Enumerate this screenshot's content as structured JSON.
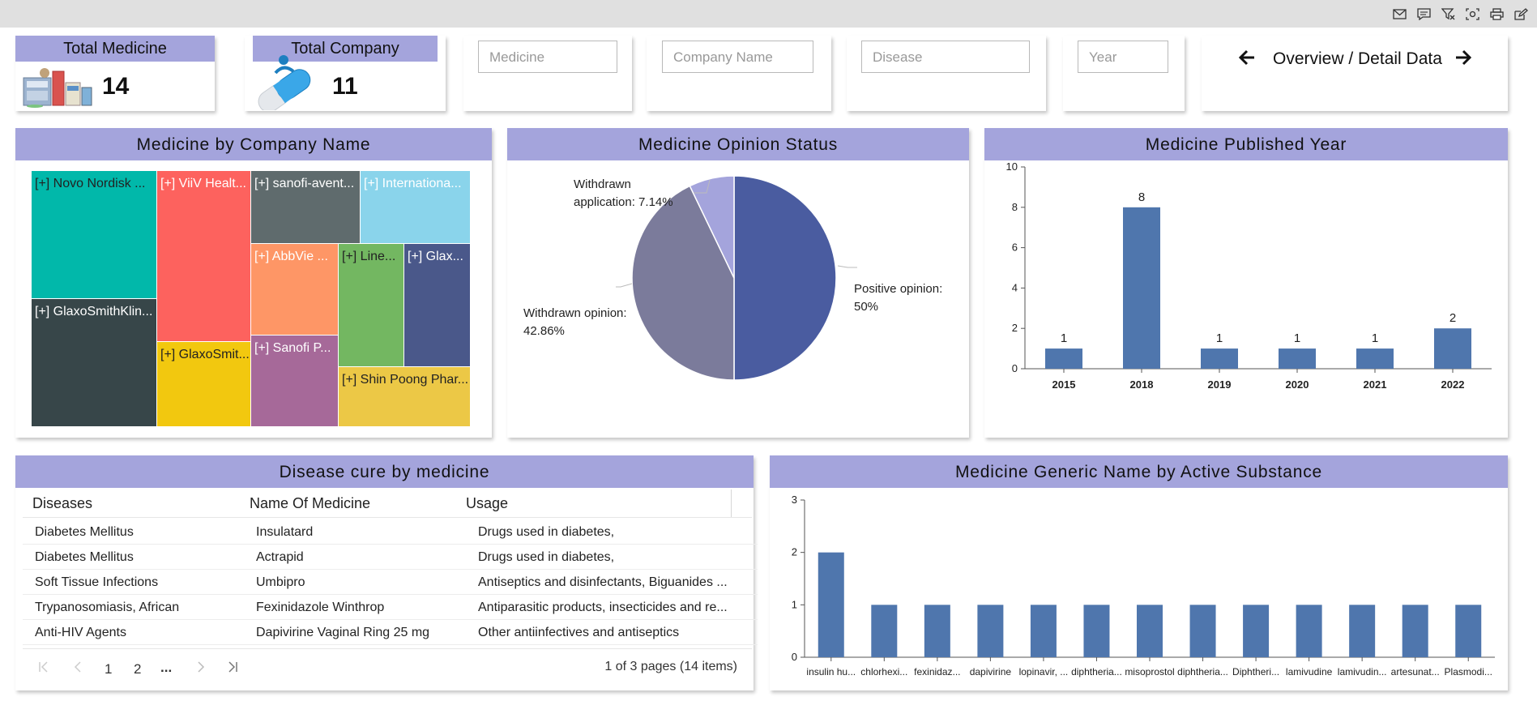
{
  "toolbar": {
    "icons": [
      "mail-icon",
      "comment-icon",
      "clear-filter-icon",
      "screenshot-icon",
      "print-icon",
      "edit-icon"
    ]
  },
  "kpis": {
    "total_medicine": {
      "label": "Total Medicine",
      "value": "14"
    },
    "total_company": {
      "label": "Total Company",
      "value": "11"
    }
  },
  "filters": {
    "medicine_placeholder": "Medicine",
    "company_placeholder": "Company Name",
    "disease_placeholder": "Disease",
    "year_placeholder": "Year"
  },
  "nav": {
    "label": "Overview / Detail Data"
  },
  "treemap": {
    "title": "Medicine by Company Name",
    "tiles": [
      {
        "label": "[+] Novo Nordisk ...",
        "color": "#01b8aa"
      },
      {
        "label": "[+] GlaxoSmithKlin...",
        "color": "#374649"
      },
      {
        "label": "[+] ViiV Healt...",
        "color": "#fd625e"
      },
      {
        "label": "[+] GlaxoSmit...",
        "color": "#f2c80f"
      },
      {
        "label": "[+] sanofi-avent...",
        "color": "#5f6b6d"
      },
      {
        "label": "[+] Internationa...",
        "color": "#8ad4eb"
      },
      {
        "label": "[+] AbbVie ...",
        "color": "#fe9666"
      },
      {
        "label": "[+] Sanofi P...",
        "color": "#a66999"
      },
      {
        "label": "[+] Line...",
        "color": "#73b761"
      },
      {
        "label": "[+] Glax...",
        "color": "#4a588a"
      },
      {
        "label": "[+] Shin Poong Phar...",
        "color": "#ecc846"
      }
    ]
  },
  "pie": {
    "title": "Medicine Opinion Status",
    "chart_data": {
      "type": "pie",
      "slices": [
        {
          "name": "Positive opinion",
          "value": 50,
          "color": "#4a5ca0"
        },
        {
          "name": "Withdrawn opinion",
          "value": 42.86,
          "color": "#7b7b9b"
        },
        {
          "name": "Withdrawn application",
          "value": 7.14,
          "color": "#a4a4dc"
        }
      ]
    },
    "labels": {
      "positive_line1": "Positive opinion:",
      "positive_line2": "50%",
      "withdrawn_op_line1": "Withdrawn opinion:",
      "withdrawn_op_line2": "42.86%",
      "withdrawn_app_line1": "Withdrawn",
      "withdrawn_app_line2": "application: 7.14%"
    }
  },
  "year_chart": {
    "title": "Medicine Published Year",
    "chart_data": {
      "type": "bar",
      "categories": [
        "2015",
        "2018",
        "2019",
        "2020",
        "2021",
        "2022"
      ],
      "values": [
        1,
        8,
        1,
        1,
        1,
        2
      ],
      "yticks": [
        "0",
        "2",
        "4",
        "6",
        "8",
        "10"
      ],
      "ylim": [
        0,
        10
      ],
      "color": "#4f76ad"
    }
  },
  "disease_table": {
    "title": "Disease cure by medicine",
    "headers": [
      "Diseases",
      "Name Of Medicine",
      "Usage"
    ],
    "rows": [
      [
        "Diabetes Mellitus",
        "Insulatard",
        "Drugs used in diabetes,"
      ],
      [
        "Diabetes Mellitus",
        "Actrapid",
        "Drugs used in diabetes,"
      ],
      [
        "Soft Tissue Infections",
        "Umbipro",
        "Antiseptics and disinfectants, Biguanides ..."
      ],
      [
        "Trypanosomiasis, African",
        "Fexinidazole Winthrop",
        "Antiparasitic products, insecticides and re..."
      ],
      [
        "Anti-HIV Agents",
        "Dapivirine Vaginal Ring 25 mg",
        "Other antiinfectives and antiseptics"
      ]
    ],
    "pager": {
      "page1": "1",
      "page2": "2",
      "ellipsis": "...",
      "summary": "1 of 3 pages (14 items)"
    }
  },
  "substance_chart": {
    "title": "Medicine Generic Name by Active Substance",
    "chart_data": {
      "type": "bar",
      "categories": [
        "insulin hu...",
        "chlorhexi...",
        "fexinidaz...",
        "dapivirine",
        "lopinavir, ...",
        "diphtheria...",
        "misoprostol",
        "diphtheria...",
        "Diphtheri...",
        "lamivudine",
        "lamivudin...",
        "artesunat...",
        "Plasmodi..."
      ],
      "values": [
        2,
        1,
        1,
        1,
        1,
        1,
        1,
        1,
        1,
        1,
        1,
        1,
        1
      ],
      "yticks": [
        "0",
        "1",
        "2",
        "3"
      ],
      "ylim": [
        0,
        3
      ],
      "color": "#4f76ad"
    }
  }
}
